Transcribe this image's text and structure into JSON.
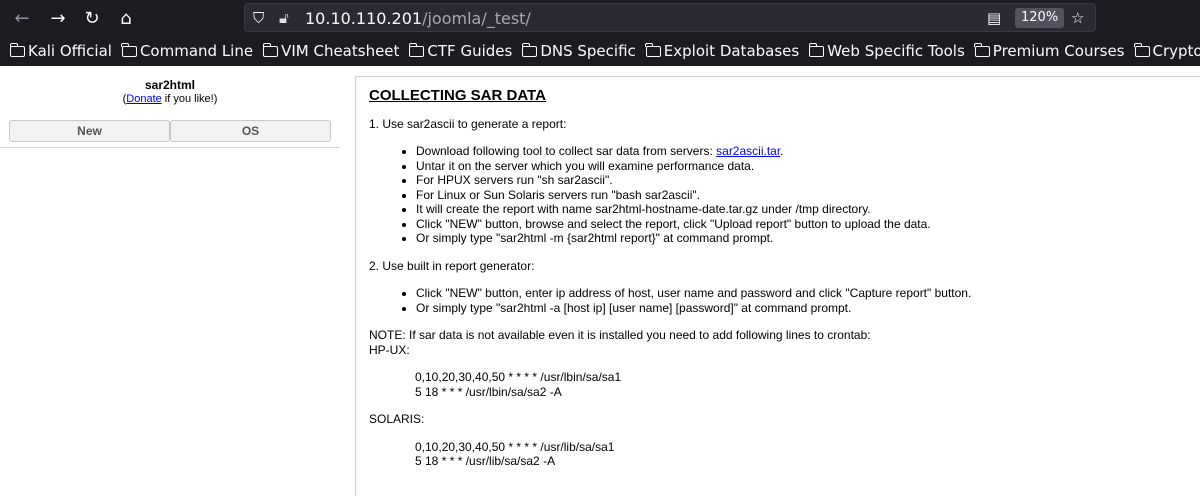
{
  "browser": {
    "url_host": "10.10.110.201",
    "url_path": "/joomla/_test/",
    "zoom": "120%",
    "bookmarks": [
      "Kali Official",
      "Command Line",
      "VIM Cheatsheet",
      "CTF Guides",
      "DNS Specific",
      "Exploit Databases",
      "Web Specific Tools",
      "Premium Courses",
      "Cryptography"
    ]
  },
  "sidebar": {
    "title": "sar2html",
    "donate_open": "(",
    "donate_link": "Donate",
    "donate_rest": " if you like!)",
    "tabs": [
      "New",
      "OS"
    ]
  },
  "content": {
    "heading": "COLLECTING SAR DATA",
    "step1": "1. Use sar2ascii to generate a report:",
    "step1_items": [
      "Download following tool to collect sar data from servers: ",
      "Untar it on the server which you will examine performance data.",
      "For HPUX servers run \"sh sar2ascii\".",
      "For Linux or Sun Solaris servers run \"bash sar2ascii\".",
      "It will create the report with name sar2html-hostname-date.tar.gz under /tmp directory.",
      "Click \"NEW\" button, browse and select the report, click \"Upload report\" button to upload the data.",
      "Or simply type \"sar2html -m {sar2html report}\" at command prompt."
    ],
    "tool_link": "sar2ascii.tar",
    "tool_link_after": ".",
    "step2": "2. Use built in report generator:",
    "step2_items": [
      "Click \"NEW\" button, enter ip address of host, user name and password and click \"Capture report\" button.",
      "Or simply type \"sar2html -a [host ip] [user name] [password]\" at command prompt."
    ],
    "note": "NOTE: If sar data is not available even it is installed you need to add following lines to crontab:",
    "hpux_label": "HP-UX:",
    "hpux_lines": [
      "0,10,20,30,40,50 * * * * /usr/lbin/sa/sa1",
      "5 18 * * * /usr/lbin/sa/sa2 -A"
    ],
    "solaris_label": "SOLARIS:",
    "solaris_lines": [
      "0,10,20,30,40,50 * * * * /usr/lib/sa/sa1",
      "5 18 * * * /usr/lib/sa/sa2 -A"
    ]
  },
  "icons": {
    "back": "back-arrow-icon",
    "forward": "forward-arrow-icon",
    "reload": "reload-icon",
    "home": "home-icon",
    "shield": "shield-icon",
    "lock": "insecure-lock-icon",
    "reader": "reader-view-icon",
    "star": "bookmark-star-icon",
    "folder": "folder-icon"
  }
}
